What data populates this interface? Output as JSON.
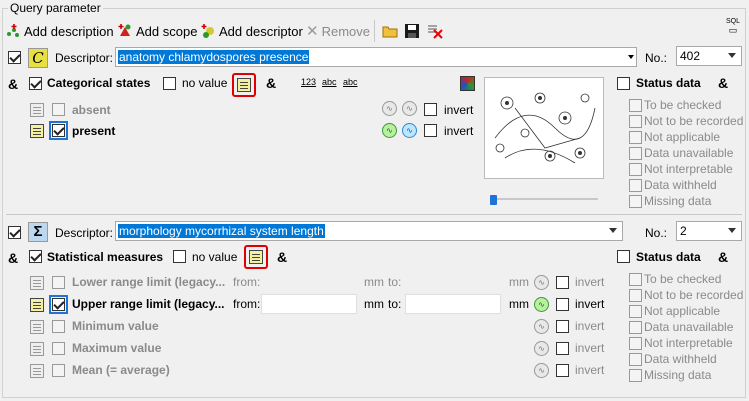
{
  "group_title": "Query parameter",
  "toolbar": {
    "add_description": "Add description",
    "add_scope": "Add scope",
    "add_descriptor": "Add descriptor",
    "remove": "Remove",
    "sql_label": "SQL"
  },
  "descriptor1": {
    "label": "Descriptor:",
    "value": "anatomy chlamydospores presence",
    "no_label": "No.:",
    "no_value": "402",
    "categorical_label": "Categorical states",
    "no_value_label": "no value",
    "amp": "&",
    "states": [
      {
        "label": "absent",
        "checked": false,
        "invert": "invert"
      },
      {
        "label": "present",
        "checked": true,
        "invert": "invert"
      }
    ],
    "op_icons": [
      "123",
      "abc",
      "abc"
    ]
  },
  "status1": {
    "title": "Status data",
    "items": [
      "To be checked",
      "Not to be recorded",
      "Not applicable",
      "Data unavailable",
      "Not interpretable",
      "Data withheld",
      "Missing data"
    ]
  },
  "descriptor2": {
    "label": "Descriptor:",
    "value": "morphology mycorrhizal system length",
    "no_label": "No.:",
    "no_value": "2",
    "statistical_label": "Statistical measures",
    "no_value_label": "no value",
    "amp": "&",
    "from_label": "from:",
    "to_label": "to:",
    "unit": "mm",
    "invert": "invert",
    "measures": [
      {
        "label": "Lower range limit (legacy...",
        "checked": false
      },
      {
        "label": "Upper range limit (legacy...",
        "checked": true
      },
      {
        "label": "Minimum value",
        "checked": false
      },
      {
        "label": "Maximum value",
        "checked": false
      },
      {
        "label": "Mean (= average)",
        "checked": false
      }
    ]
  },
  "status2": {
    "title": "Status data",
    "items": [
      "To be checked",
      "Not to be recorded",
      "Not applicable",
      "Data unavailable",
      "Not interpretable",
      "Data withheld",
      "Missing data"
    ]
  },
  "amp_symbol": "&"
}
